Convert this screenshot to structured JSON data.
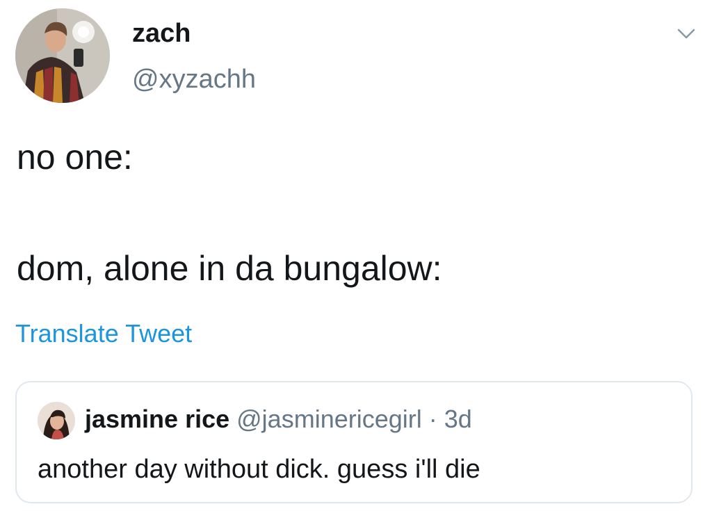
{
  "tweet": {
    "author_name": "zach",
    "author_handle": "@xyzachh",
    "text_line1": "no one:",
    "text_line2": "dom, alone in da bungalow:",
    "translate_label": "Translate Tweet",
    "menu_icon": "chevron-down-icon"
  },
  "quoted_tweet": {
    "author_name": "jasmine rice",
    "author_handle": "@jasminericegirl",
    "separator": "·",
    "time": "3d",
    "text": "another day without dick. guess i'll die"
  },
  "colors": {
    "text_primary": "#14171a",
    "text_secondary": "#657786",
    "link": "#1b95e0",
    "border": "#e1e8ed"
  }
}
